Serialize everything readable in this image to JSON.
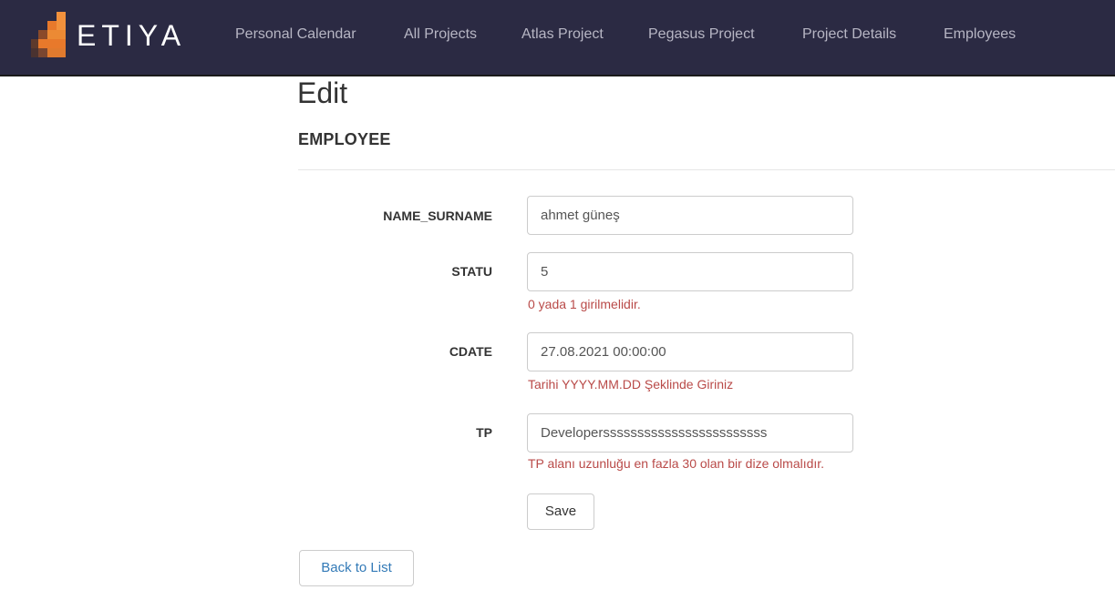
{
  "brand": {
    "name": "ETIYA",
    "colors": {
      "navbar": "#2b2a43",
      "accent": "#e8792b",
      "error": "#b94a48",
      "link": "#337ab7"
    }
  },
  "nav": {
    "items": [
      {
        "label": "Personal Calendar"
      },
      {
        "label": "All Projects"
      },
      {
        "label": "Atlas Project"
      },
      {
        "label": "Pegasus Project"
      },
      {
        "label": "Project Details"
      },
      {
        "label": "Employees"
      }
    ]
  },
  "page": {
    "title": "Edit",
    "section": "EMPLOYEE"
  },
  "form": {
    "fields": [
      {
        "label": "NAME_SURNAME",
        "value": "ahmet güneş",
        "error": ""
      },
      {
        "label": "STATU",
        "value": "5",
        "error": "0 yada 1 girilmelidir."
      },
      {
        "label": "CDATE",
        "value": "27.08.2021 00:00:00",
        "error": "Tarihi YYYY.MM.DD Şeklinde Giriniz"
      },
      {
        "label": "TP",
        "value": "Developerssssssssssssssssssssssss",
        "error": "TP alanı uzunluğu en fazla 30 olan bir dize olmalıdır."
      }
    ],
    "save_label": "Save"
  },
  "back_label": "Back to List"
}
